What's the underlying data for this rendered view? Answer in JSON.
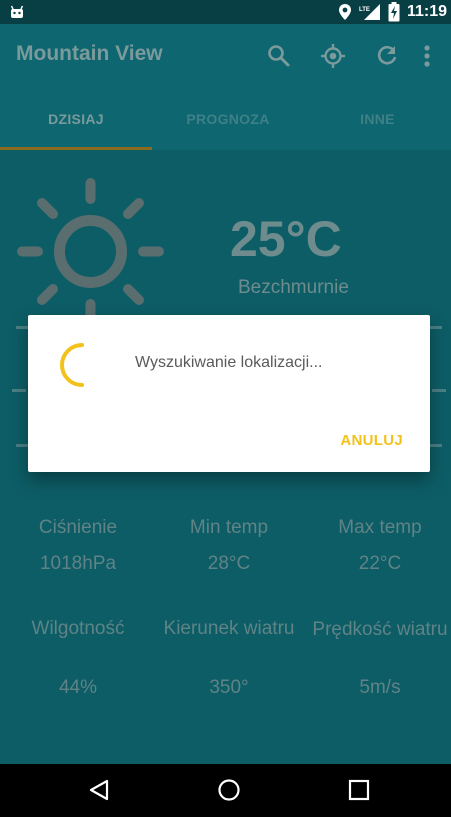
{
  "status_bar": {
    "time": "11:19",
    "network_label": "LTE",
    "icons": [
      "android-icon",
      "location-icon",
      "lte-signal-icon",
      "battery-charging-icon"
    ]
  },
  "app_bar": {
    "title": "Mountain View",
    "actions": [
      "search-icon",
      "my-location-icon",
      "refresh-icon",
      "more-vert-icon"
    ]
  },
  "tabs": [
    {
      "label": "DZISIAJ",
      "active": true
    },
    {
      "label": "PROGNOZA",
      "active": false
    },
    {
      "label": "INNE",
      "active": false
    }
  ],
  "weather": {
    "temperature": "25°C",
    "description": "Bezchmurnie"
  },
  "stats": {
    "row1": [
      {
        "label": "Ciśnienie",
        "value": "1018hPa"
      },
      {
        "label": "Min temp",
        "value": "28°C"
      },
      {
        "label": "Max temp",
        "value": "22°C"
      }
    ],
    "row2": [
      {
        "label": "Wilgotność",
        "value": "44%"
      },
      {
        "label": "Kierunek wiatru",
        "value": "350°"
      },
      {
        "label": "Prędkość wiatru",
        "value": "5m/s"
      }
    ]
  },
  "dialog": {
    "message": "Wyszukiwanie lokalizacji...",
    "cancel_label": "ANULUJ"
  },
  "colors": {
    "accent": "#f2c21b",
    "background": "#0d5d66",
    "status_bar": "#083f45"
  },
  "navigation": [
    "back-icon",
    "home-icon",
    "recents-icon"
  ]
}
